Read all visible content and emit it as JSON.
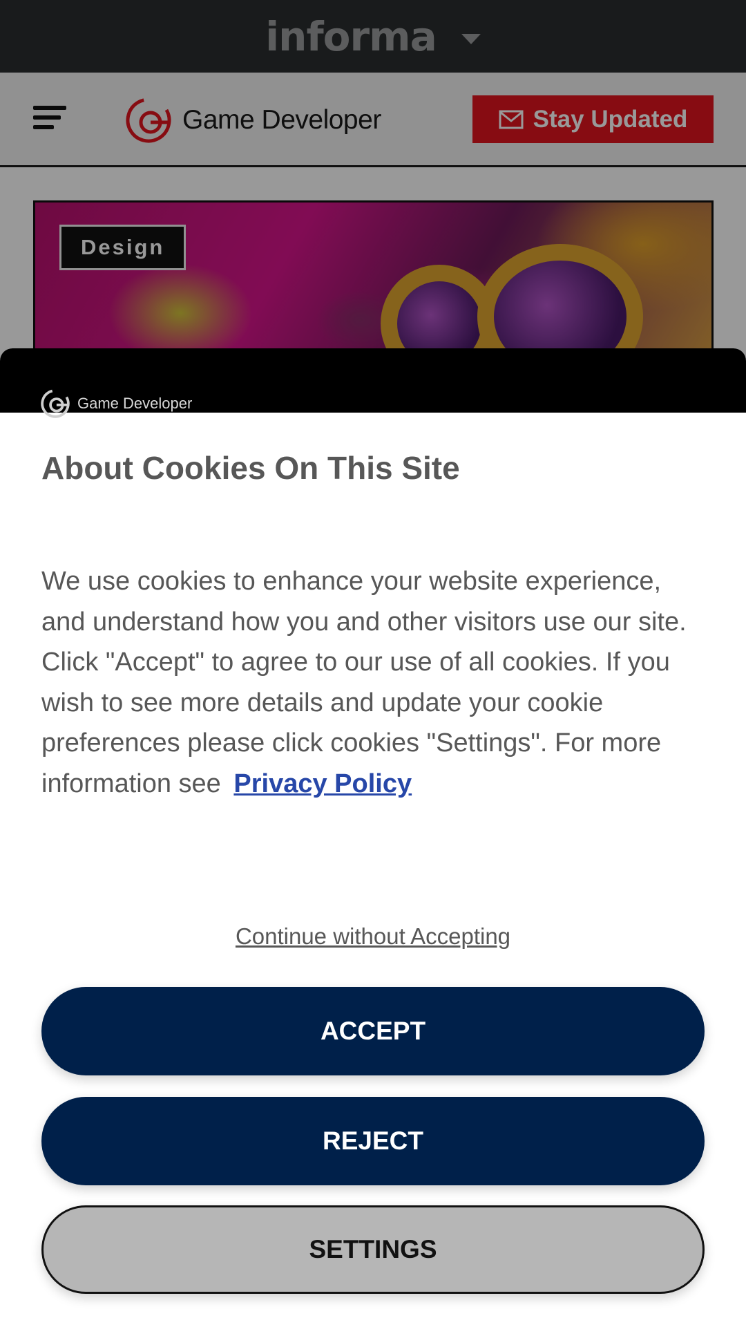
{
  "top_bar": {
    "brand": "informa"
  },
  "header": {
    "site_name": "Game Developer",
    "subscribe_label": "Stay Updated"
  },
  "article": {
    "category_tag": "Design"
  },
  "cookie_modal": {
    "brand": "Game Developer",
    "title": "About Cookies On This Site",
    "body": "We use cookies to enhance your website experience, and understand how you and other visitors use our site. Click \"Accept\" to agree to our use of all cookies. If you wish to see more details and update your cookie preferences please click cookies \"Settings\". For more information see",
    "privacy_link": "Privacy Policy",
    "continue_link": "Continue without Accepting",
    "accept_label": "ACCEPT",
    "reject_label": "REJECT",
    "settings_label": "SETTINGS"
  },
  "colors": {
    "accent_red": "#e1141e",
    "button_navy": "#00204a",
    "link_blue": "#2747a8"
  }
}
